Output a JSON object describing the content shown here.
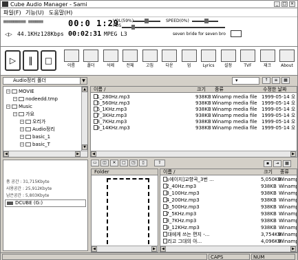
{
  "window": {
    "title": "Cube Audio Manager - Sami"
  },
  "menu": [
    "파일(F)",
    "기능(U)",
    "도움말(H)"
  ],
  "player": {
    "lcd_top_left": "▦▦▦▦▦▦▦▦▦ ▦▦▦▦▦▦",
    "time1": "00:0 1:29",
    "vol_label": "VOL(59%)",
    "pos_label": "POS",
    "speed_label": "SPEED(0%)",
    "freq": "44.1KHz",
    "bitrate": "128Kbps",
    "time2": "00:02:31",
    "format": "MPEG L3",
    "track_name": "seven bride for seven bro"
  },
  "toolbar": {
    "buttons": [
      {
        "label": "이름",
        "icon": "rename-icon"
      },
      {
        "label": "폴더",
        "icon": "folder-icon"
      },
      {
        "label": "삭제",
        "icon": "delete-icon"
      },
      {
        "label": "전체",
        "icon": "select-all-icon"
      },
      {
        "label": "고침",
        "icon": "refresh-icon"
      },
      {
        "label": "다운",
        "icon": "download-icon"
      },
      {
        "label": "업",
        "icon": "upload-icon"
      },
      {
        "label": "Lyrics",
        "icon": "lyrics-icon"
      },
      {
        "label": "설정",
        "icon": "settings-icon"
      },
      {
        "label": "TVF",
        "icon": "tvf-icon"
      },
      {
        "label": "재크",
        "icon": "check-icon"
      },
      {
        "label": "About",
        "icon": "about-icon"
      }
    ]
  },
  "local": {
    "drive_combo": "Audio정리 폴더",
    "tree": [
      {
        "label": "MOVIE",
        "indent": 0
      },
      {
        "label": "nodeedd.tmp",
        "indent": 1
      },
      {
        "label": "Music",
        "indent": 0
      },
      {
        "label": "가요",
        "indent": 1
      },
      {
        "label": "오리가",
        "indent": 2
      },
      {
        "label": "Audio정리",
        "indent": 2
      },
      {
        "label": "basic_1",
        "indent": 2
      },
      {
        "label": "basic_T",
        "indent": 2
      }
    ],
    "list_headers": [
      "이름 /",
      "크기",
      "종류",
      "수정한 날짜"
    ],
    "files": [
      {
        "name": "01_280Hz.mp3",
        "size": "938KB",
        "type": "Winamp media file",
        "date": "1999-05-14 오"
      },
      {
        "name": "05_560Hz.mp3",
        "size": "938KB",
        "type": "Winamp media file",
        "date": "1999-05-14 오"
      },
      {
        "name": "06_1KHz.mp3",
        "size": "938KB",
        "type": "Winamp media file",
        "date": "1999-05-14 오"
      },
      {
        "name": "07_3KHz.mp3",
        "size": "938KB",
        "type": "Winamp media file",
        "date": "1999-05-14 오"
      },
      {
        "name": "08_7KHz.mp3",
        "size": "938KB",
        "type": "Winamp media file",
        "date": "1999-05-14 오"
      },
      {
        "name": "09_14KHz.mp3",
        "size": "938KB",
        "type": "Winamp media file",
        "date": "1999-05-14 오"
      }
    ],
    "combo_right": "▾"
  },
  "device": {
    "total_space": "총 공간 : 31,715Kbyte",
    "used_space": "사용공간 : 25,912Kbyte",
    "free_space": "남은공간 : 5,803Kbyte",
    "device_name": "DCUBE (G:)",
    "folder_header": "Folder",
    "list_headers": [
      "이름 /",
      "크기",
      "종류"
    ],
    "files": [
      {
        "name": "[뉴에이지]교향곡_3번 ...",
        "size": "5,050KB",
        "type": "Winamp"
      },
      {
        "name": "02_40Hz.mp3",
        "size": "938KB",
        "type": "Winamp"
      },
      {
        "name": "03_100Hz.mp3",
        "size": "938KB",
        "type": "Winamp"
      },
      {
        "name": "04_200Hz.mp3",
        "size": "938KB",
        "type": "Winamp"
      },
      {
        "name": "05_500Hz.mp3",
        "size": "938KB",
        "type": "Winamp"
      },
      {
        "name": "07_5KHz.mp3",
        "size": "938KB",
        "type": "Winamp"
      },
      {
        "name": "08_7KHz.mp3",
        "size": "938KB",
        "type": "Winamp"
      },
      {
        "name": "09_12KHz.mp3",
        "size": "938KB",
        "type": "Winamp"
      },
      {
        "name": "그대에게 쓰는 편지 -...",
        "size": "3,754KB",
        "type": "Winamp"
      },
      {
        "name": "그리고 그대의 아...",
        "size": "4,096KB",
        "type": "Winamp"
      }
    ]
  },
  "status": {
    "caps": "CAPS",
    "num": "NUM"
  }
}
